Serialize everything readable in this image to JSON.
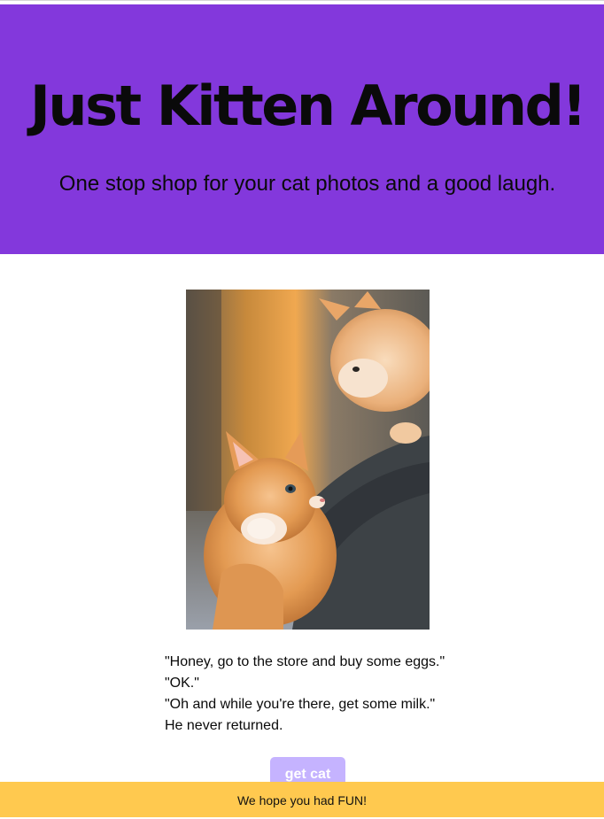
{
  "header": {
    "title": "Just Kitten Around!",
    "subtitle": "One stop shop for your cat photos and a good laugh."
  },
  "photo": {
    "alt": "two orange kittens"
  },
  "joke": {
    "lines": [
      "\"Honey, go to the store and buy some eggs.\"",
      "\"OK.\"",
      "\"Oh and while you're there, get some milk.\"",
      "He never returned."
    ]
  },
  "button": {
    "label": "get cat"
  },
  "footer": {
    "text": "We hope you had FUN!"
  },
  "colors": {
    "hero_bg": "#8338dc",
    "button_bg": "#c5b3ff",
    "footer_bg": "#ffc94f"
  }
}
